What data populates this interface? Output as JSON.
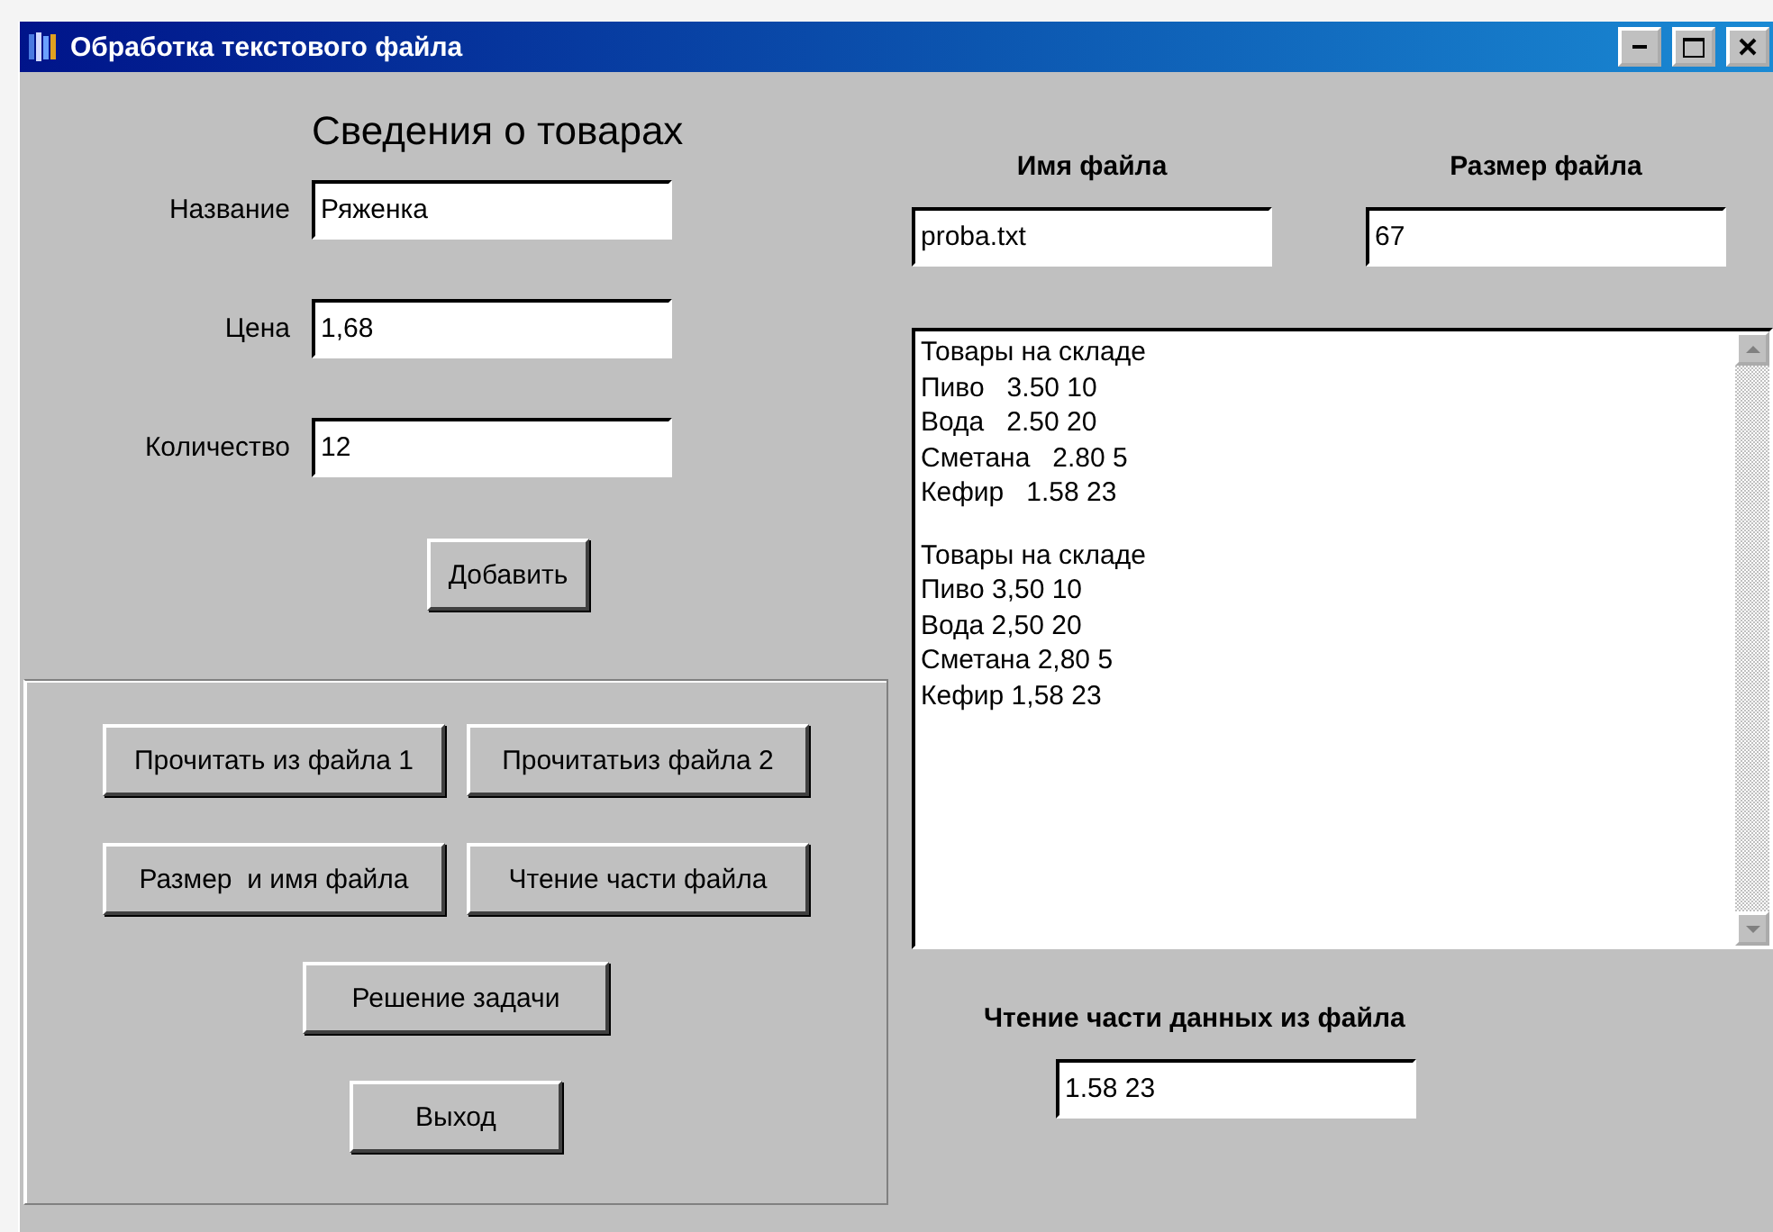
{
  "window": {
    "title": "Обработка текстового файла"
  },
  "heading": "Сведения о товарах",
  "fields": [
    {
      "label": "Название",
      "value": "Ряженка"
    },
    {
      "label": "Цена",
      "value": "1,68"
    },
    {
      "label": "Количество",
      "value": "12"
    }
  ],
  "add_button": "Добавить",
  "button_rows": [
    {
      "buttons": [
        "Прочитать из файла 1",
        "Прочитатьиз файла 2"
      ]
    },
    {
      "buttons": [
        "Размер  и имя файла",
        "Чтение части файла"
      ]
    },
    {
      "buttons": [
        "Решение задачи"
      ]
    },
    {
      "buttons": [
        "Выход"
      ]
    }
  ],
  "file_name": {
    "label": "Имя файла",
    "value": "proba.txt"
  },
  "file_size": {
    "label": "Размер файла",
    "value": "67"
  },
  "memo": {
    "blocks": [
      [
        "Товары на складе",
        "Пиво   3.50 10",
        "Вода   2.50 20",
        "Сметана   2.80 5",
        "Кефир   1.58 23"
      ],
      [
        "Товары на складе",
        "Пиво 3,50 10",
        "Вода 2,50 20",
        "Сметана 2,80 5",
        "Кефир 1,58 23"
      ]
    ]
  },
  "partial_read": {
    "label": "Чтение части данных из файла",
    "value": "1.58 23"
  }
}
